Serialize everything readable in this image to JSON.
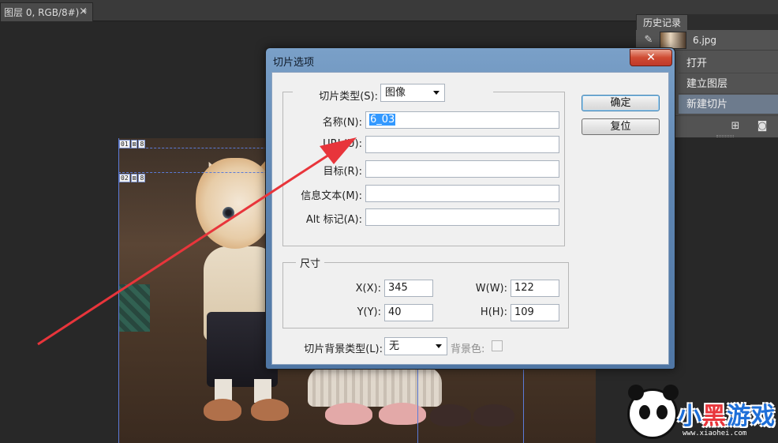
{
  "document_tab": {
    "title": "图层 0, RGB/8#) *",
    "close_glyph": "×"
  },
  "canvas": {
    "slices": [
      {
        "number": "01",
        "type_glyph": "⊠",
        "count": "8"
      },
      {
        "number": "02",
        "type_glyph": "⊠",
        "count": "8"
      }
    ]
  },
  "history_panel": {
    "tab_label": "历史记录",
    "snapshot_label": "6.jpg",
    "items": [
      {
        "label": "打开",
        "active": false
      },
      {
        "label": "建立图层",
        "active": false
      },
      {
        "label": "新建切片",
        "active": true
      }
    ],
    "icons": [
      "history-brush-icon",
      "new-document-icon",
      "camera-icon"
    ]
  },
  "dialog": {
    "title": "切片选项",
    "close_glyph": "✕",
    "slice_type_label": "切片类型(S):",
    "slice_type_value": "图像",
    "name_label": "名称(N):",
    "name_value": "6_03",
    "url_label": "URL(U):",
    "url_value": "",
    "target_label": "目标(R):",
    "target_value": "",
    "message_label": "信息文本(M):",
    "message_value": "",
    "alt_label": "Alt 标记(A):",
    "alt_value": "",
    "dimensions_legend": "尺寸",
    "x_label": "X(X):",
    "x_value": "345",
    "y_label": "Y(Y):",
    "y_value": "40",
    "w_label": "W(W):",
    "w_value": "122",
    "h_label": "H(H):",
    "h_value": "109",
    "bg_type_label": "切片背景类型(L):",
    "bg_type_value": "无",
    "bg_color_label": "背景色:",
    "ok_label": "确定",
    "reset_label": "复位"
  },
  "watermark": {
    "brand_part1": "小",
    "brand_part2": "黑",
    "brand_part3": "游戏",
    "url": "www.xiaohei.com"
  },
  "colors": {
    "workspace_bg": "#282828",
    "panel_bg": "#535353",
    "history_active": "#6d7b8d",
    "selection_highlight": "#3399ff",
    "annotation_arrow": "#e8353b",
    "slice_guide": "#5b7bd8"
  }
}
